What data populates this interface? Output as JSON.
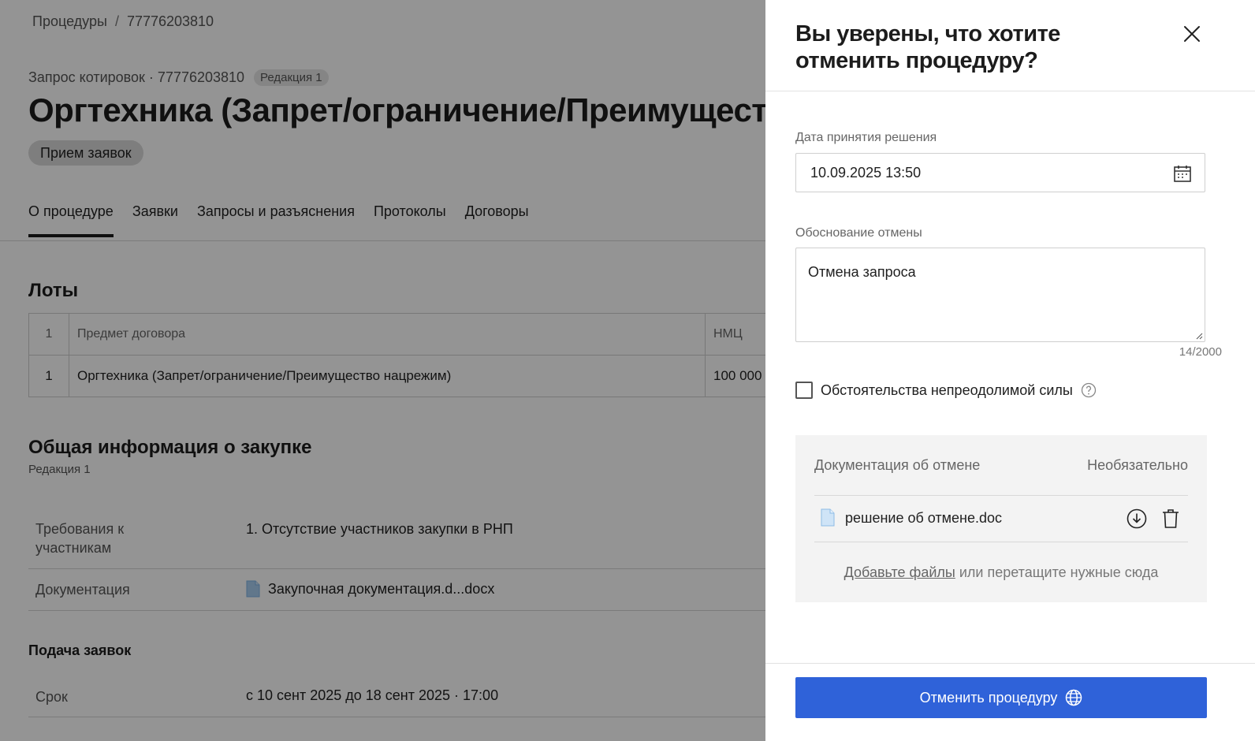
{
  "breadcrumb": {
    "root": "Процедуры",
    "separator": "/",
    "current": "77776203810"
  },
  "procedure": {
    "type_line": "Запрос котировок · 77776203810",
    "redaction_badge": "Редакция 1",
    "title": "Оргтехника (Запрет/ограничение/Преимущество нацрежим)",
    "status": "Прием заявок"
  },
  "tabs": [
    {
      "label": "О процедуре",
      "active": true
    },
    {
      "label": "Заявки"
    },
    {
      "label": "Запросы и разъяснения"
    },
    {
      "label": "Протоколы"
    },
    {
      "label": "Договоры"
    }
  ],
  "lots": {
    "title": "Лоты",
    "header": {
      "num": "1",
      "subject": "Предмет договора",
      "nmc": "НМЦ"
    },
    "rows": [
      {
        "num": "1",
        "subject": "Оргтехника (Запрет/ограничение/Преимущество нацрежим)",
        "nmc": "100 000"
      }
    ]
  },
  "general": {
    "title": "Общая информация о закупке",
    "subtitle": "Редакция 1",
    "rows": [
      {
        "label": "Требования к участникам",
        "value": "1. Отсутствие участников закупки в РНП"
      },
      {
        "label": "Документация",
        "value": "Закупочная документация.d...docx"
      }
    ]
  },
  "applications": {
    "title": "Подача заявок",
    "deadline_label": "Срок",
    "deadline_value": "с 10 сент 2025 до 18 сент 2025 · 17:00"
  },
  "drawer": {
    "title": "Вы уверены, что хотите отменить процедуру?",
    "date_label": "Дата принятия решения",
    "date_value": "10.09.2025 13:50",
    "reason_label": "Обоснование отмены",
    "reason_value": "Отмена запроса",
    "reason_counter": "14/2000",
    "force_majeure_label": "Обстоятельства непреодолимой силы",
    "force_majeure_checked": false,
    "docs": {
      "title": "Документация об отмене",
      "optional": "Необязательно",
      "files": [
        {
          "name": "решение об отмене.doc"
        }
      ],
      "add_link": "Добавьте файлы",
      "add_rest": " или перетащите нужные сюда"
    },
    "submit_label": "Отменить процедуру"
  },
  "colors": {
    "primary": "#2f62d9",
    "overlay": "rgba(0,0,0,0.42)",
    "file_icon": "#a8cdf0"
  },
  "icons": [
    "close-icon",
    "calendar-icon",
    "help-icon",
    "file-icon",
    "download-icon",
    "trash-icon",
    "globe-icon",
    "resize-handle-icon"
  ]
}
